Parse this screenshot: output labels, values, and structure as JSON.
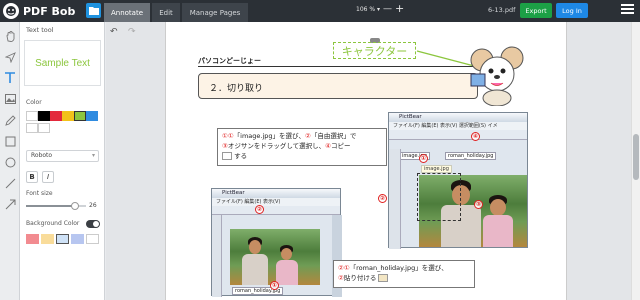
{
  "app": {
    "name": "PDF Bob",
    "tabs": [
      {
        "label": "Annotate",
        "active": true
      },
      {
        "label": "Edit",
        "active": false
      },
      {
        "label": "Manage Pages",
        "active": false
      }
    ],
    "zoom": "106 %",
    "filename": "6-13.pdf",
    "export_label": "Export",
    "login_label": "Log In"
  },
  "toolbar_icons": [
    "hand-icon",
    "pointer-icon",
    "text-icon",
    "image-icon",
    "pen-icon",
    "rectangle-icon",
    "circle-icon",
    "line-icon",
    "arrow-icon"
  ],
  "panel": {
    "title": "Text tool",
    "sample_text": "Sample Text",
    "color_label": "Color",
    "colors": [
      "#ffffff",
      "#000000",
      "#e3293b",
      "#f2c21a",
      "#8cc63e",
      "#2f8be0",
      "#ffffff",
      "#ffffff"
    ],
    "font_family": "Roboto",
    "bold_label": "B",
    "italic_label": "I",
    "font_size_label": "Font size",
    "font_size_value": "26",
    "font_size_fraction": 0.82,
    "bg_color_label": "Background Color",
    "bg_colors": [
      "#f28b90",
      "#f9dc9a",
      "#cfe2f7",
      "#b7c6f0",
      "#ffffff"
    ]
  },
  "document": {
    "heading": "パソコンどーじょー",
    "section": "２．切り取り",
    "character_label": "キャラクター",
    "callout1": {
      "n1": "①①",
      "t1": "「image.jpg」を選び、",
      "n2": "②",
      "t2": "「自由選択」で",
      "n3": "③",
      "t3": "オジサンをドラッグして選択し、",
      "n4": "④",
      "t4": "コピー",
      "t5": "する"
    },
    "callout2": {
      "n1": "②①",
      "t1": "「roman_holiday.jpg」を選び、",
      "n2": "②",
      "t2": "貼り付ける"
    },
    "window1": {
      "title": "PictBear",
      "menu": "ファイル(F)  編集(E)  表示(V)  選択範囲(S)  イメ",
      "tab1": "image.jpg",
      "tab2": "roman_holiday.jpg",
      "img_label": "image.jpg"
    },
    "window2": {
      "title": "PictBear",
      "menu": "ファイル(F) 編集(E) 表示(V)",
      "tab1": "image.jpg",
      "tab2": "roman_holiday.jpg"
    },
    "badges": [
      "①",
      "②",
      "③",
      "④",
      "②",
      "①"
    ]
  }
}
